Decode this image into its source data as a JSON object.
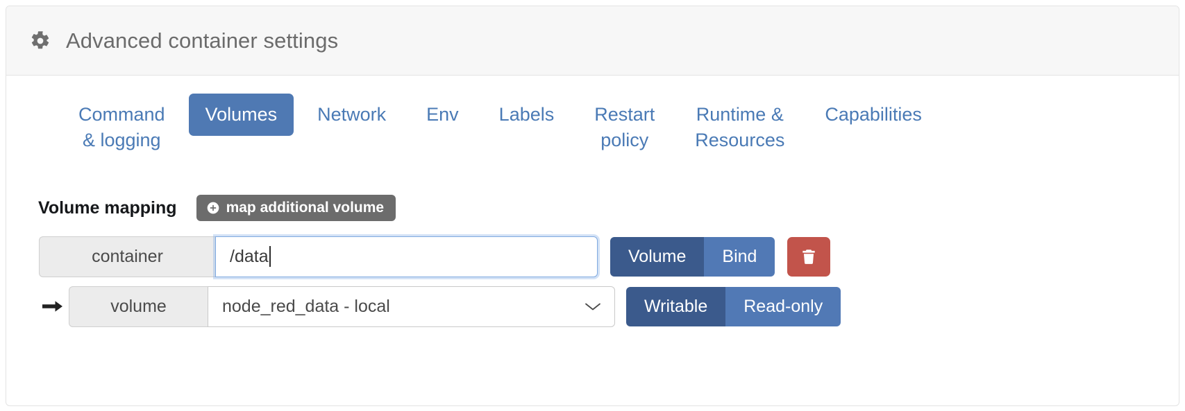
{
  "header": {
    "title": "Advanced container settings",
    "icon": "gear-icon"
  },
  "tabs": [
    {
      "label": "Command\n& logging",
      "active": false
    },
    {
      "label": "Volumes",
      "active": true
    },
    {
      "label": "Network",
      "active": false
    },
    {
      "label": "Env",
      "active": false
    },
    {
      "label": "Labels",
      "active": false
    },
    {
      "label": "Restart\npolicy",
      "active": false
    },
    {
      "label": "Runtime &\nResources",
      "active": false
    },
    {
      "label": "Capabilities",
      "active": false
    }
  ],
  "volume_mapping": {
    "section_label": "Volume mapping",
    "add_button_label": "map additional volume",
    "add_button_icon": "plus-circle-icon",
    "rows": {
      "container": {
        "prefix_label": "container",
        "value": "/data",
        "placeholder": "",
        "type_toggle": {
          "options": [
            "Volume",
            "Bind"
          ],
          "selected": "Volume"
        },
        "delete_icon": "trash-icon"
      },
      "volume": {
        "arrow_icon": "arrow-right-icon",
        "prefix_label": "volume",
        "selected_option": "node_red_data - local",
        "chevron_icon": "chevron-down-icon",
        "access_toggle": {
          "options": [
            "Writable",
            "Read-only"
          ],
          "selected": "Writable"
        }
      }
    }
  },
  "colors": {
    "tab_active_bg": "#4f79b3",
    "tab_link": "#4a7ab5",
    "toggle_on": "#3b5a8c",
    "toggle_off": "#5179b5",
    "delete_bg": "#c2544b",
    "add_button_bg": "#6c6c6c",
    "header_bg": "#f7f7f7"
  }
}
